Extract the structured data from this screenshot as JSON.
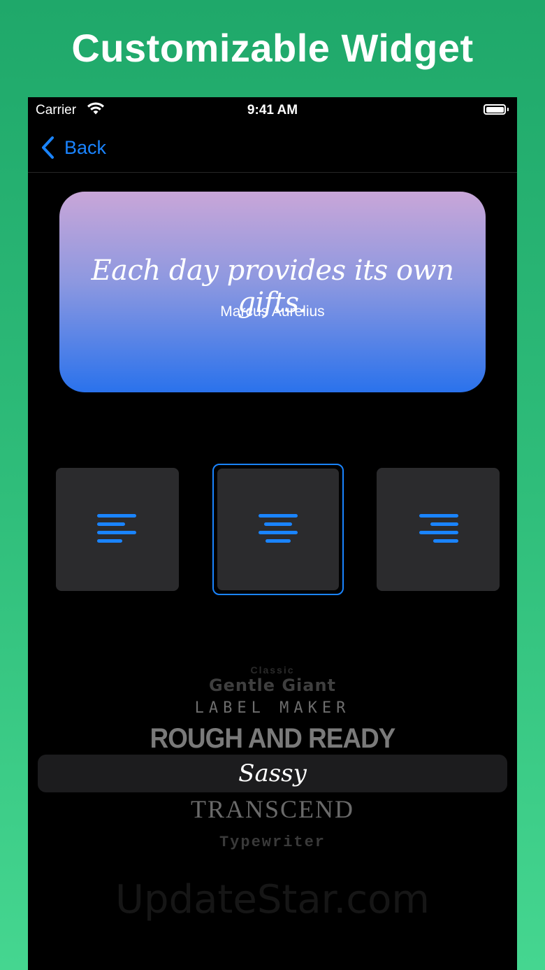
{
  "headline": "Customizable Widget",
  "status_bar": {
    "carrier": "Carrier",
    "time": "9:41 AM",
    "icons": [
      "wifi-icon",
      "battery-icon"
    ]
  },
  "nav": {
    "back_label": "Back",
    "back_icon": "chevron-left-icon"
  },
  "widget": {
    "quote": "Each day provides its own gifts.",
    "author": "Marcus Aurelius",
    "gradient": [
      "#c9a6d8",
      "#2a72ec"
    ]
  },
  "alignment": {
    "options": [
      {
        "name": "align-left",
        "icon": "text-align-left-icon",
        "selected": false
      },
      {
        "name": "align-center",
        "icon": "text-align-center-icon",
        "selected": true
      },
      {
        "name": "align-right",
        "icon": "text-align-right-icon",
        "selected": false
      }
    ]
  },
  "font_picker": {
    "items": [
      "Classic",
      "Gentle Giant",
      "LABEL MAKER",
      "ROUGH AND READY",
      "Sassy",
      "TRANSCEND",
      "Typewriter"
    ],
    "selected": "Sassy"
  },
  "watermark": "UpdateStar.com",
  "colors": {
    "accent": "#1a84ff",
    "background_top": "#1fa86a",
    "background_bottom": "#45d690",
    "tile": "#2b2b2d"
  }
}
